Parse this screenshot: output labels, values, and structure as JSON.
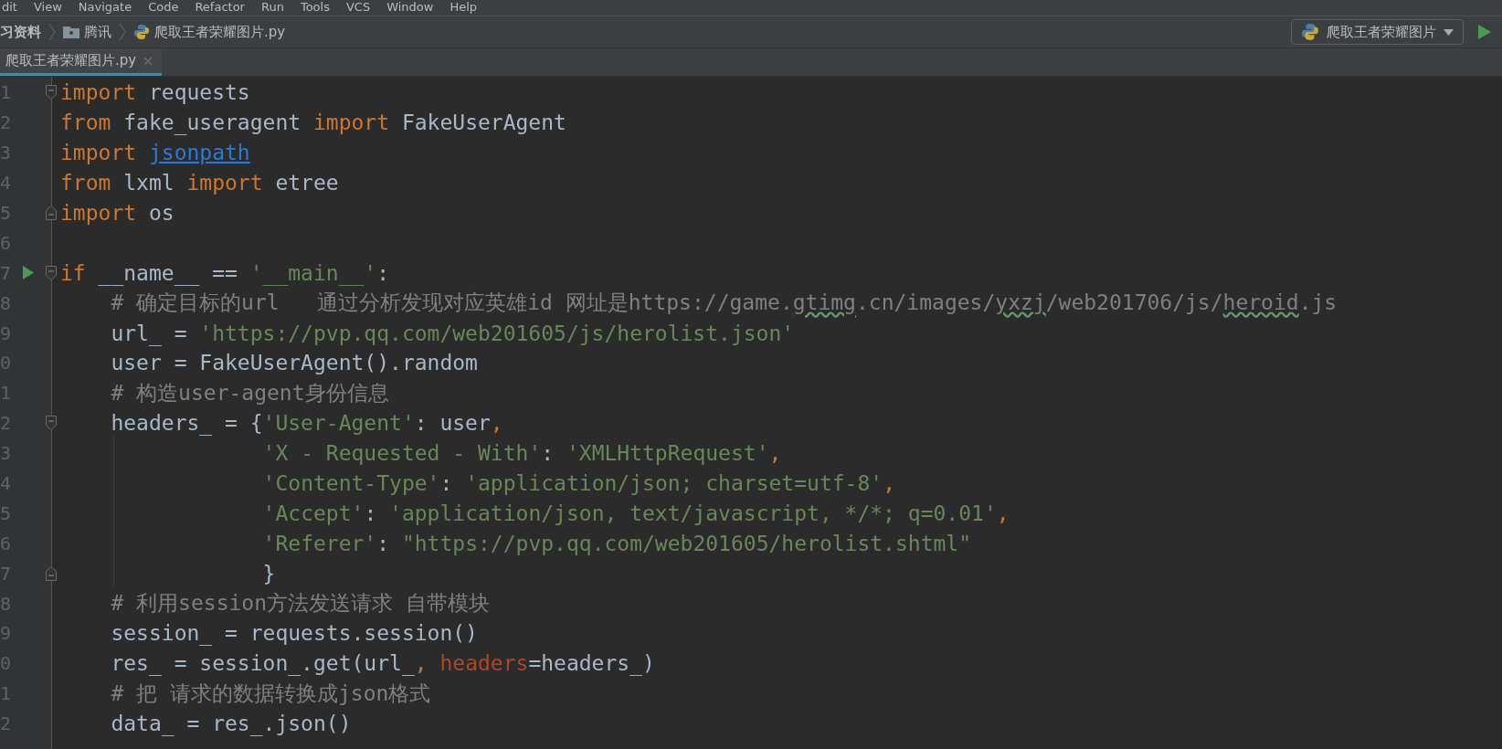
{
  "menu": [
    "dit",
    "View",
    "Navigate",
    "Code",
    "Refactor",
    "Run",
    "Tools",
    "VCS",
    "Window",
    "Help"
  ],
  "breadcrumb": [
    {
      "label": "习资料",
      "kind": "plain"
    },
    {
      "label": "腾讯",
      "kind": "folder"
    },
    {
      "label": "爬取王者荣耀图片.py",
      "kind": "python"
    }
  ],
  "run_config": {
    "label": "爬取王者荣耀图片"
  },
  "tabs": [
    {
      "label": "爬取王者荣耀图片.py",
      "selected": true
    }
  ],
  "editor": {
    "lines": [
      {
        "num": "1",
        "fold_start": true,
        "fold_end": false,
        "run": false,
        "tokens": [
          {
            "t": "import",
            "kind": "kw"
          },
          {
            "t": " requests",
            "kind": "plain"
          }
        ]
      },
      {
        "num": "2",
        "fold_start": false,
        "fold_end": false,
        "run": false,
        "tokens": [
          {
            "t": "from",
            "kind": "kw"
          },
          {
            "t": " fake_useragent ",
            "kind": "plain"
          },
          {
            "t": "import",
            "kind": "kw"
          },
          {
            "t": " FakeUserAgent",
            "kind": "plain"
          }
        ]
      },
      {
        "num": "3",
        "fold_start": false,
        "fold_end": false,
        "run": false,
        "tokens": [
          {
            "t": "import ",
            "kind": "kw"
          },
          {
            "t": "jsonpath",
            "kind": "link"
          }
        ]
      },
      {
        "num": "4",
        "fold_start": false,
        "fold_end": false,
        "run": false,
        "tokens": [
          {
            "t": "from",
            "kind": "kw"
          },
          {
            "t": " lxml ",
            "kind": "plain"
          },
          {
            "t": "import",
            "kind": "kw"
          },
          {
            "t": " etree",
            "kind": "plain"
          }
        ]
      },
      {
        "num": "5",
        "fold_start": false,
        "fold_end": true,
        "run": false,
        "tokens": [
          {
            "t": "import",
            "kind": "kw"
          },
          {
            "t": " os",
            "kind": "plain"
          }
        ]
      },
      {
        "num": "6",
        "fold_start": false,
        "fold_end": false,
        "run": false
      },
      {
        "num": "7",
        "fold_start": true,
        "fold_end": false,
        "run": true,
        "tokens": [
          {
            "t": "if",
            "kind": "kw"
          },
          {
            "t": " __name__ == ",
            "kind": "plain"
          },
          {
            "t": "'__main__'",
            "kind": "str"
          },
          {
            "t": ":",
            "kind": "plain"
          }
        ],
        "children": [
          {
            "num": "8",
            "fold_start": false,
            "fold_end": false,
            "run": false,
            "tokens": [
              {
                "t": "# 确定目标的url   通过分析发现对应英雄id 网址是https://game.",
                "kind": "comment"
              },
              {
                "t": "gtimg",
                "kind": "typo"
              },
              {
                "t": ".cn/images/",
                "kind": "comment"
              },
              {
                "t": "yxzj",
                "kind": "typo"
              },
              {
                "t": "/web201706/js/",
                "kind": "comment"
              },
              {
                "t": "heroid",
                "kind": "typo"
              },
              {
                "t": ".js",
                "kind": "comment"
              }
            ]
          },
          {
            "num": "9",
            "fold_start": false,
            "fold_end": false,
            "run": false,
            "tokens": [
              {
                "t": "url_ = ",
                "kind": "plain"
              },
              {
                "t": "'https://pvp.qq.com/web201605/js/herolist.json'",
                "kind": "str"
              }
            ]
          },
          {
            "num": "0",
            "fold_start": false,
            "fold_end": false,
            "run": false,
            "tokens": [
              {
                "t": "user = FakeUserAgent().random",
                "kind": "plain"
              }
            ]
          },
          {
            "num": "1",
            "fold_start": false,
            "fold_end": false,
            "run": false,
            "tokens": [
              {
                "t": "# 构造user-agent身份信息",
                "kind": "comment"
              }
            ]
          },
          {
            "num": "2",
            "fold_start": true,
            "fold_end": false,
            "run": false,
            "tokens": [
              {
                "t": "headers_ = {",
                "kind": "plain"
              },
              {
                "t": "'User-Agent'",
                "kind": "str"
              },
              {
                "t": ": user",
                "kind": "plain"
              },
              {
                "t": ",",
                "kind": "kw"
              }
            ]
          },
          {
            "num": "3",
            "fold_start": false,
            "fold_end": false,
            "run": false,
            "continuation": true,
            "tokens": [
              {
                "t": "'X - Requested - With'",
                "kind": "str"
              },
              {
                "t": ": ",
                "kind": "plain"
              },
              {
                "t": "'XMLHttpRequest'",
                "kind": "str"
              },
              {
                "t": ",",
                "kind": "kw"
              }
            ]
          },
          {
            "num": "4",
            "fold_start": false,
            "fold_end": false,
            "run": false,
            "continuation": true,
            "tokens": [
              {
                "t": "'Content-Type'",
                "kind": "str"
              },
              {
                "t": ": ",
                "kind": "plain"
              },
              {
                "t": "'application/json; charset=utf-8'",
                "kind": "str"
              },
              {
                "t": ",",
                "kind": "kw"
              }
            ]
          },
          {
            "num": "5",
            "fold_start": false,
            "fold_end": false,
            "run": false,
            "continuation": true,
            "tokens": [
              {
                "t": "'Accept'",
                "kind": "str"
              },
              {
                "t": ": ",
                "kind": "plain"
              },
              {
                "t": "'application/json, text/javascript, */*; q=0.01'",
                "kind": "str"
              },
              {
                "t": ",",
                "kind": "kw"
              }
            ]
          },
          {
            "num": "6",
            "fold_start": false,
            "fold_end": false,
            "run": false,
            "continuation": true,
            "tokens": [
              {
                "t": "'Referer'",
                "kind": "str"
              },
              {
                "t": ": ",
                "kind": "plain"
              },
              {
                "t": "\"https://pvp.qq.com/web201605/herolist.shtml\"",
                "kind": "str"
              }
            ]
          },
          {
            "num": "7",
            "fold_start": false,
            "fold_end": true,
            "run": false,
            "continuation": true,
            "tokens": [
              {
                "t": "}",
                "kind": "plain"
              }
            ]
          },
          {
            "num": "8",
            "fold_start": false,
            "fold_end": false,
            "run": false,
            "tokens": [
              {
                "t": "# 利用session方法发送请求 自带模块",
                "kind": "comment"
              }
            ]
          },
          {
            "num": "9",
            "fold_start": false,
            "fold_end": false,
            "run": false,
            "tokens": [
              {
                "t": "session_ = requests.session()",
                "kind": "plain"
              }
            ]
          },
          {
            "num": "0",
            "fold_start": false,
            "fold_end": false,
            "run": false,
            "tokens": [
              {
                "t": "res_ = session_.get(url_",
                "kind": "plain"
              },
              {
                "t": ", ",
                "kind": "kw"
              },
              {
                "t": "headers",
                "kind": "param"
              },
              {
                "t": "=headers_)",
                "kind": "plain"
              }
            ]
          },
          {
            "num": "1",
            "fold_start": false,
            "fold_end": false,
            "run": false,
            "tokens": [
              {
                "t": "# 把 请求的数据转换成json格式",
                "kind": "comment"
              }
            ]
          },
          {
            "num": "2",
            "fold_start": false,
            "fold_end": false,
            "run": false,
            "tokens": [
              {
                "t": "data_ = res_.json()",
                "kind": "plain"
              }
            ]
          }
        ]
      }
    ]
  }
}
